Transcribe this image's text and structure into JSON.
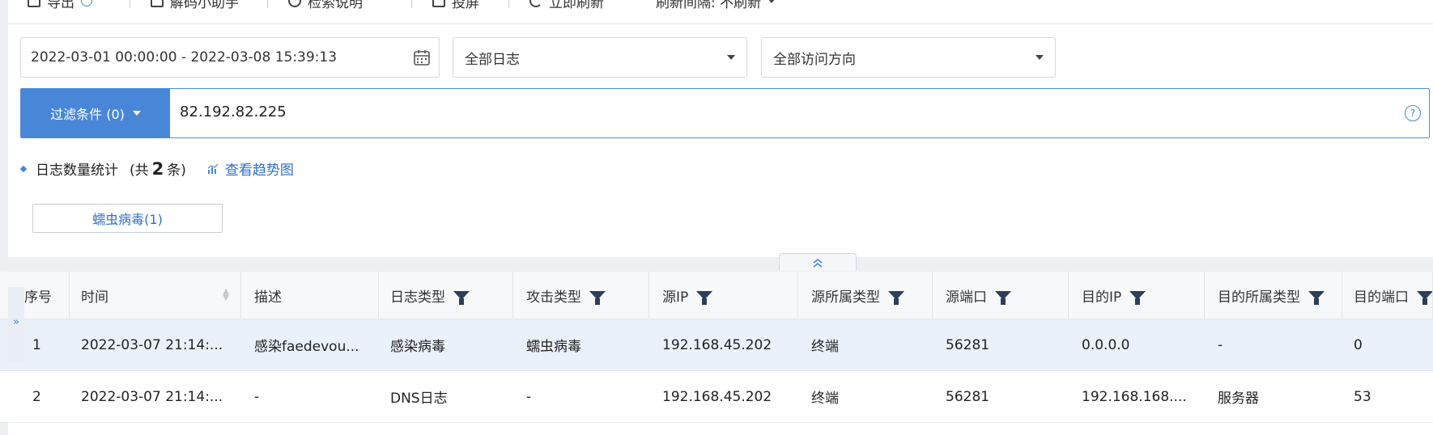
{
  "toolbar": {
    "items": [
      {
        "label": "导出",
        "icon": "export-icon"
      },
      {
        "label": "解码小助手",
        "icon": "decoder-icon"
      },
      {
        "label": "检索说明",
        "icon": "info-icon"
      },
      {
        "label": "投屏",
        "icon": "screen-cast-icon"
      },
      {
        "label": "立即刷新",
        "icon": "refresh-icon"
      },
      {
        "label": "刷新间隔: 不刷新"
      }
    ]
  },
  "search": {
    "date_range": "2022-03-01 00:00:00 - 2022-03-08 15:39:13",
    "log_type": "全部日志",
    "direction": "全部访问方向",
    "filter_button": "过滤条件 (0)",
    "query": "82.192.82.225"
  },
  "stats": {
    "label": "日志数量统计",
    "prefix": "(共",
    "count": "2",
    "suffix": "条)",
    "trend_link": "查看趋势图"
  },
  "tags": [
    {
      "label": "蠕虫病毒(1)"
    }
  ],
  "table": {
    "columns": [
      "序号",
      "时间",
      "描述",
      "日志类型",
      "攻击类型",
      "源IP",
      "源所属类型",
      "源端口",
      "目的IP",
      "目的所属类型",
      "目的端口"
    ],
    "rows": [
      [
        "1",
        "2022-03-07 21:14:...",
        "感染faedevou...",
        "感染病毒",
        "蠕虫病毒",
        "192.168.45.202",
        "终端",
        "56281",
        "0.0.0.0",
        "-",
        "0"
      ],
      [
        "2",
        "2022-03-07 21:14:...",
        "-",
        "DNS日志",
        "-",
        "192.168.45.202",
        "终端",
        "56281",
        "192.168.168....",
        "服务器",
        "53"
      ]
    ]
  },
  "colors": {
    "accent": "#4a86d8",
    "link": "#2f6fc6",
    "selected_row": "#eaf1fb"
  }
}
